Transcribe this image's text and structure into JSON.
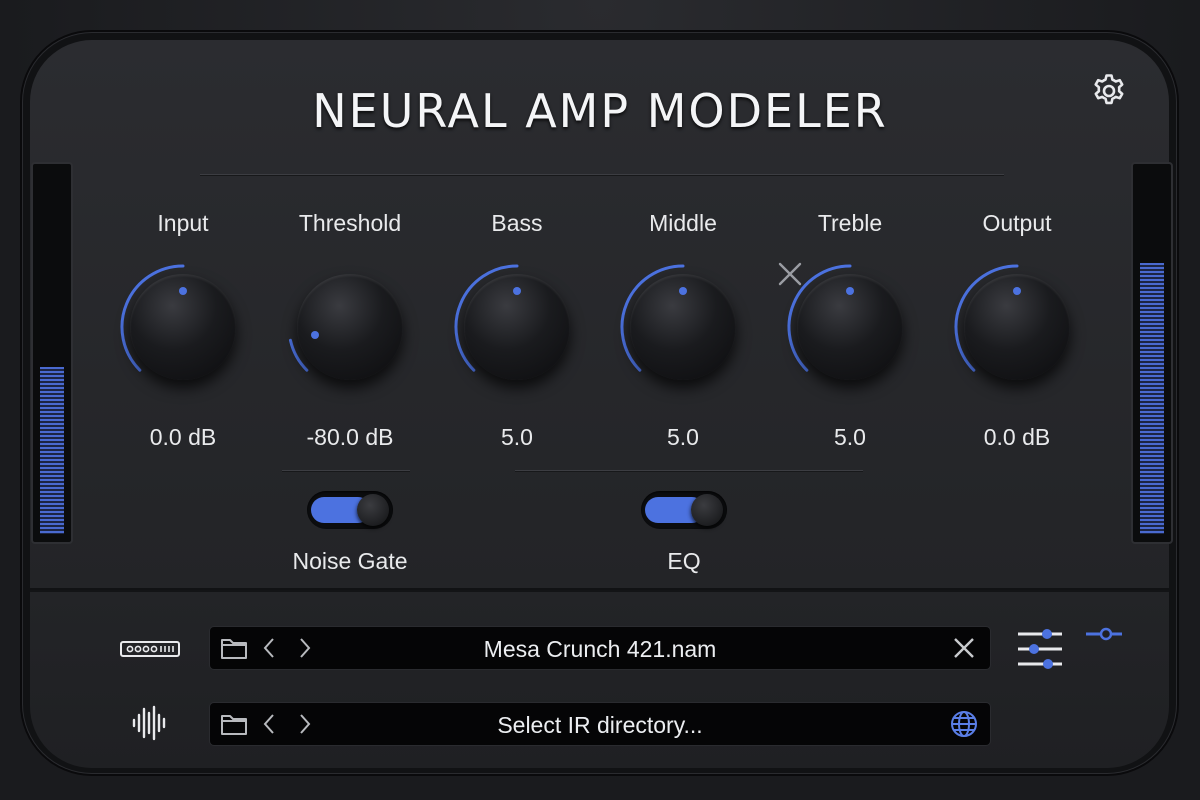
{
  "app": {
    "title": "NEURAL AMP MODELER"
  },
  "colors": {
    "accent": "#4c72e0",
    "background": "#2b2c30",
    "text": "#e9eaec"
  },
  "header": {
    "settings_icon": "gear-icon"
  },
  "knobs": [
    {
      "label": "Input",
      "value": "0.0 dB",
      "fraction": 0.5
    },
    {
      "label": "Threshold",
      "value": "-80.0 dB",
      "fraction": 0.12
    },
    {
      "label": "Bass",
      "value": "5.0",
      "fraction": 0.5
    },
    {
      "label": "Middle",
      "value": "5.0",
      "fraction": 0.5
    },
    {
      "label": "Treble",
      "value": "5.0",
      "fraction": 0.5
    },
    {
      "label": "Output",
      "value": "0.0 dB",
      "fraction": 0.5
    }
  ],
  "toggles": {
    "noise_gate": {
      "label": "Noise Gate",
      "on": true
    },
    "eq": {
      "label": "EQ",
      "on": true
    }
  },
  "meters": {
    "input_level": 0.46,
    "output_level": 0.75
  },
  "model_bar": {
    "file_name": "Mesa Crunch 421.nam",
    "left_icon": "amp-model-icon",
    "clear_icon": "close-icon"
  },
  "ir_bar": {
    "file_name": "Select IR directory...",
    "left_icon": "waveform-icon",
    "right_icon": "globe-icon"
  },
  "side_controls": {
    "sliders_icon": "sliders-icon",
    "single_slider_icon": "slider-toggle-icon"
  }
}
